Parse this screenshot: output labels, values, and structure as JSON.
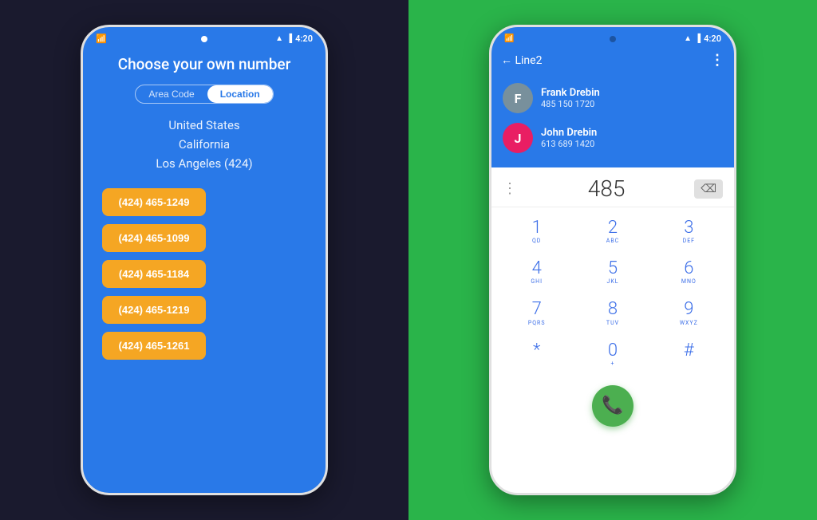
{
  "left_bg_color": "#1a1a2e",
  "right_bg_color": "#2ab44a",
  "left_phone": {
    "status_bar": {
      "time": "4:20"
    },
    "title": "Choose your own number",
    "toggle": {
      "area_code_label": "Area Code",
      "location_label": "Location",
      "active": "Location"
    },
    "steps": [
      "United States",
      "California",
      "Los Angeles (424)"
    ],
    "numbers": [
      "(424) 465-1249",
      "(424) 465-1099",
      "(424) 465-1184",
      "(424) 465-1219",
      "(424) 465-1261"
    ]
  },
  "right_phone": {
    "status_bar": {
      "time": "4:20"
    },
    "header": {
      "back_label": "← Line2",
      "more_icon": "⋮"
    },
    "contacts": [
      {
        "initial": "F",
        "name": "Frank Drebin",
        "number": "485 150 1720",
        "avatar_color": "#78909c"
      },
      {
        "initial": "J",
        "name": "John Drebin",
        "number": "613 689 1420",
        "avatar_color": "#e91e63"
      }
    ],
    "dialer": {
      "current_input": "485",
      "dots_icon": "⋮",
      "backspace_icon": "⌫"
    },
    "keypad": [
      {
        "main": "1",
        "sub": "QD"
      },
      {
        "main": "2",
        "sub": "ABC"
      },
      {
        "main": "3",
        "sub": "DEF"
      },
      {
        "main": "4",
        "sub": "GHI"
      },
      {
        "main": "5",
        "sub": "JKL"
      },
      {
        "main": "6",
        "sub": "MNO"
      },
      {
        "main": "7",
        "sub": "PQRS"
      },
      {
        "main": "8",
        "sub": "TUV"
      },
      {
        "main": "9",
        "sub": "WXYZ"
      },
      {
        "main": "*",
        "sub": ""
      },
      {
        "main": "0",
        "sub": "+"
      },
      {
        "main": "#",
        "sub": ""
      }
    ]
  }
}
